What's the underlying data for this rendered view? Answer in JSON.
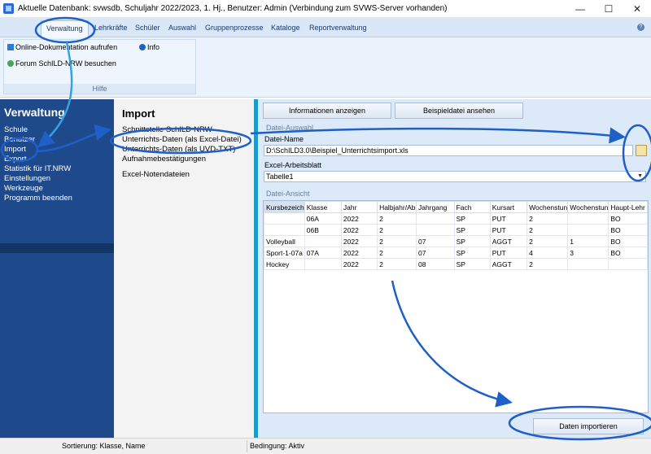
{
  "window": {
    "title": "Aktuelle Datenbank: svwsdb, Schuljahr 2022/2023, 1. Hj., Benutzer: Admin (Verbindung zum SVWS-Server vorhanden)",
    "minimize": "—",
    "maximize": "☐",
    "close": "✕"
  },
  "ribbon": {
    "tabs": [
      "Verwaltung",
      "Lehrkräfte",
      "Schüler",
      "Auswahl",
      "Gruppenprozesse",
      "Kataloge",
      "Reportverwaltung"
    ],
    "active_tab": "Verwaltung",
    "help_glyph": "?",
    "buttons": {
      "online_doc": "Online-Dokumentation aufrufen",
      "info": "Info",
      "forum": "Forum SchILD-NRW besuchen"
    },
    "group_label": "Hilfe"
  },
  "nav": {
    "heading": "Verwaltung",
    "items": [
      "Schule",
      "Benutzer",
      "Import",
      "Export",
      "Statistik für IT.NRW",
      "Einstellungen",
      "Werkzeuge",
      "Programm beenden"
    ],
    "selected": "Import"
  },
  "submenu": {
    "heading": "Import",
    "items": [
      "Schnittstelle SchILD-NRW",
      "Unterrichts-Daten (als Excel-Datei)",
      "Unterrichts-Daten (als UVD-TXT)",
      "Aufnahmebestätigungen",
      "Excel-Notendateien"
    ]
  },
  "main": {
    "btn_info": "Informationen anzeigen",
    "btn_example": "Beispieldatei ansehen",
    "section_file": "Datei-Auswahl",
    "label_filename": "Datei-Name",
    "filename": "D:\\SchILD3.0\\Beispiel_Unterrichtsimport.xls",
    "label_sheet": "Excel-Arbeitsblatt",
    "sheet": "Tabelle1",
    "section_view": "Datei-Ansicht",
    "btn_import": "Daten importieren"
  },
  "table": {
    "headers": [
      "Kursbezeich",
      "Klasse",
      "Jahr",
      "Halbjahr/Ab",
      "Jahrgang",
      "Fach",
      "Kursart",
      "Wochenstun",
      "Wochenstun",
      "Haupt-Lehr"
    ],
    "rows": [
      [
        "",
        "06A",
        "2022",
        "2",
        "",
        "SP",
        "PUT",
        "2",
        "",
        "BO"
      ],
      [
        "",
        "06B",
        "2022",
        "2",
        "",
        "SP",
        "PUT",
        "2",
        "",
        "BO"
      ],
      [
        "Volleyball",
        "",
        "2022",
        "2",
        "07",
        "SP",
        "AGGT",
        "2",
        "1",
        "BO"
      ],
      [
        "Sport-1-07a",
        "07A",
        "2022",
        "2",
        "07",
        "SP",
        "PUT",
        "4",
        "3",
        "BO"
      ],
      [
        "Hockey",
        "",
        "2022",
        "2",
        "08",
        "SP",
        "AGGT",
        "2",
        "",
        ""
      ]
    ]
  },
  "status": {
    "sort": "Sortierung: Klasse, Name",
    "condition": "Bedingung: Aktiv"
  },
  "colors": {
    "nav_bg": "#1e4a8c",
    "accent": "#1d9bc6",
    "annotation": "#1f5fc9"
  }
}
